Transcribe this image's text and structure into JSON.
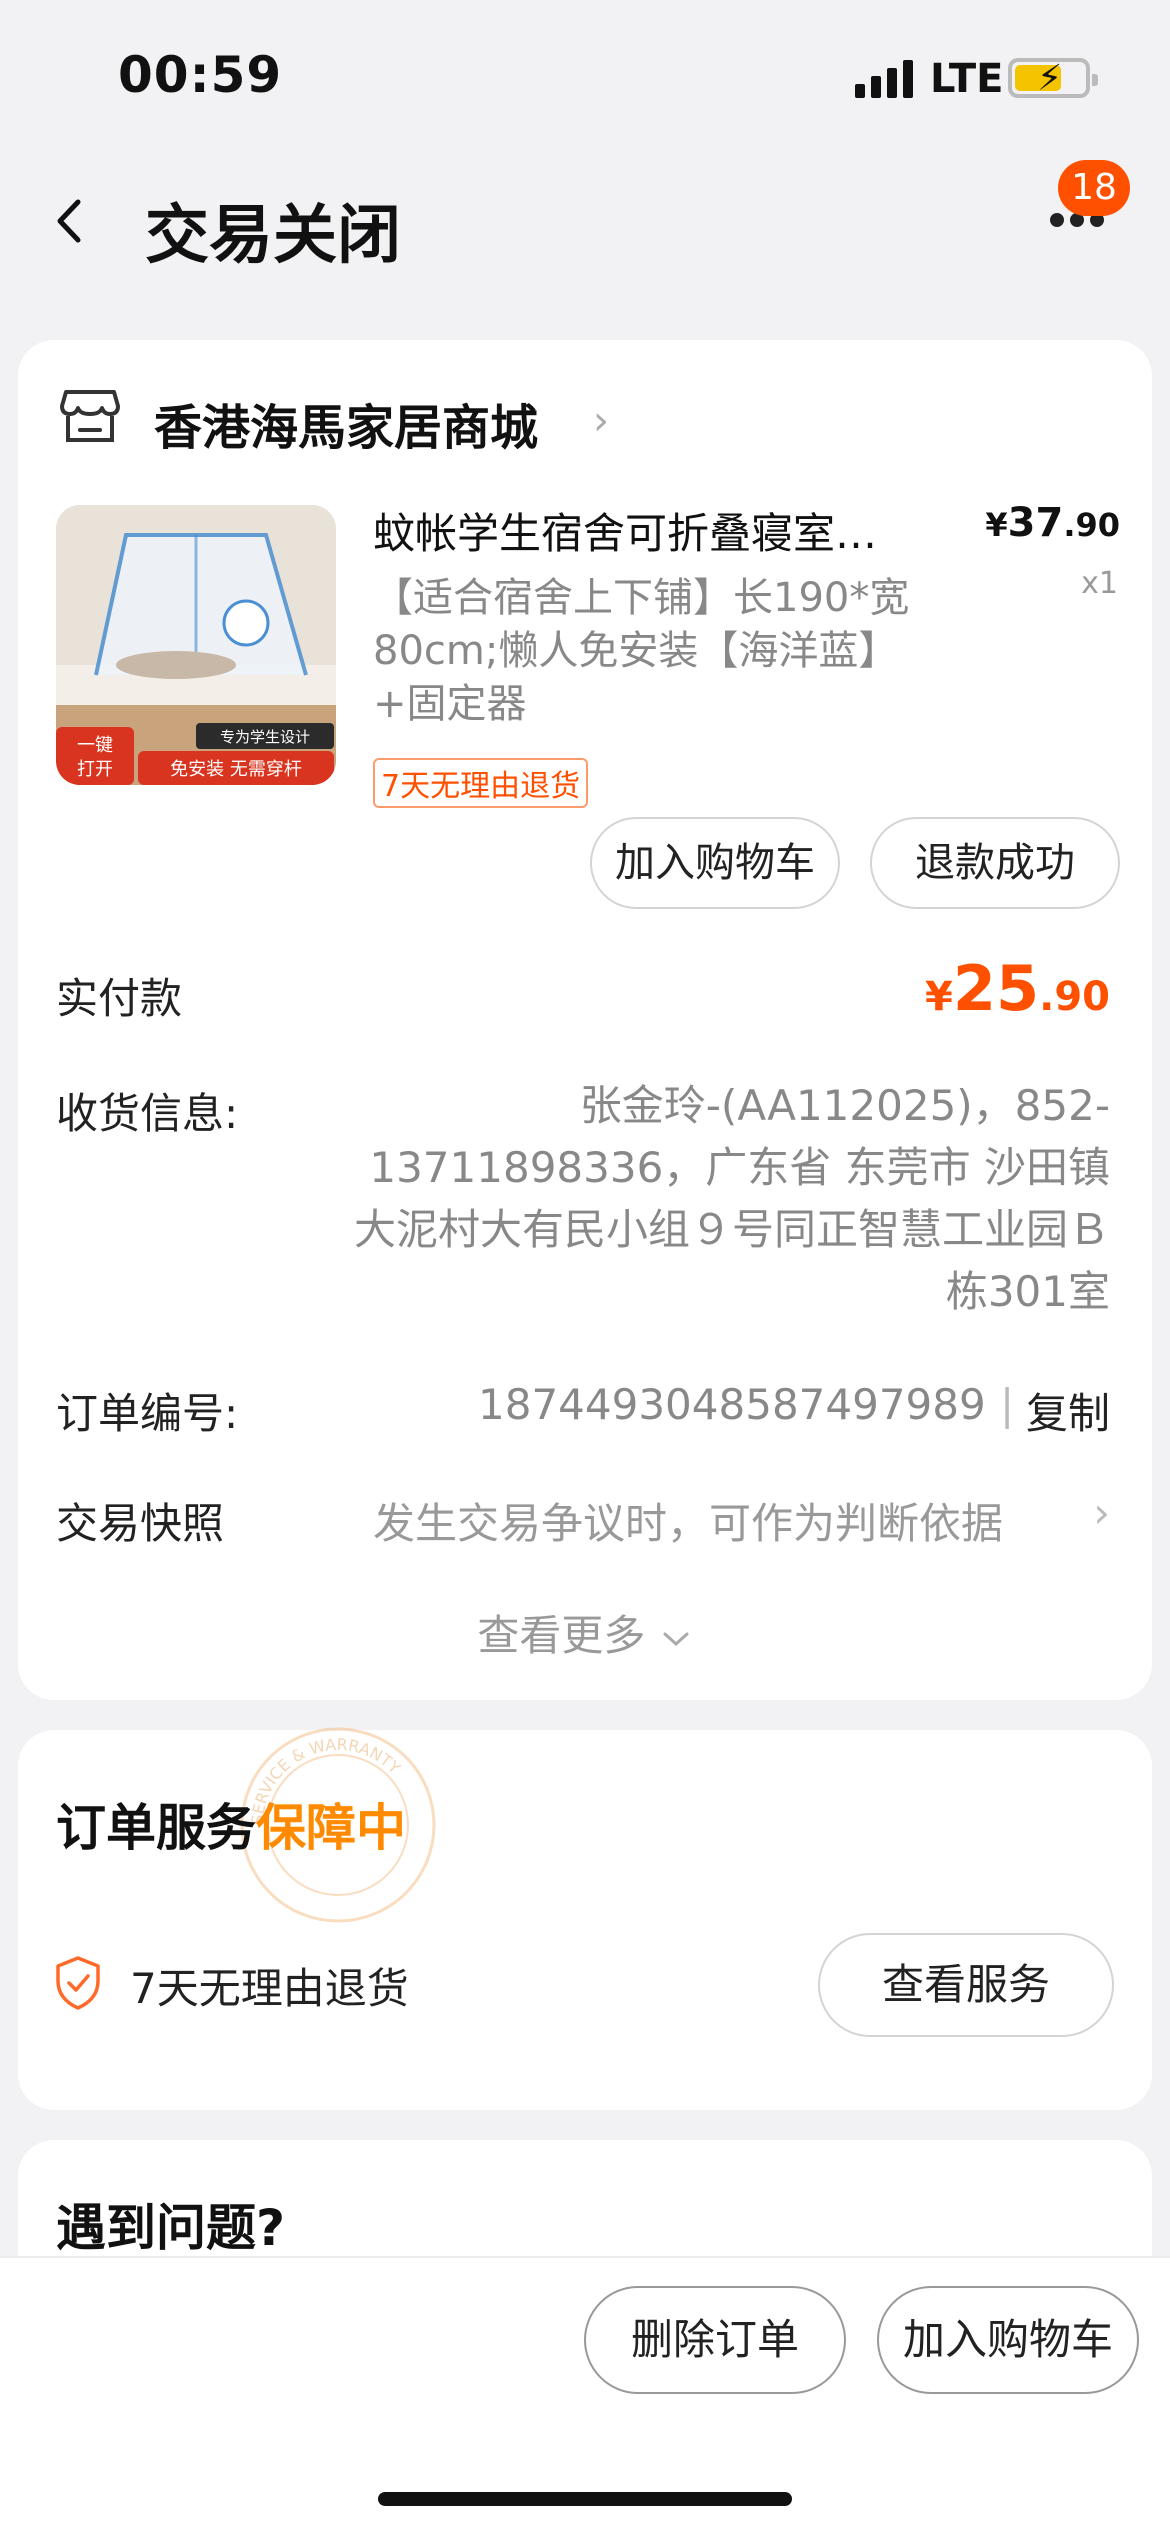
{
  "status_bar": {
    "time": "00:59",
    "network": "LTE"
  },
  "header": {
    "title": "交易关闭",
    "badge_count": "18"
  },
  "shop": {
    "name": "香港海馬家居商城"
  },
  "product": {
    "title": "蚊帐学生宿舍可折叠寝室…",
    "price_symbol": "¥",
    "price_int": "37",
    "price_dec": ".90",
    "qty": "x1",
    "spec": "【适合宿舍上下铺】长190*宽80cm;懒人免安装【海洋蓝】+固定器",
    "return_tag": "7天无理由退货",
    "thumb_texts": {
      "promo1": "一键打开",
      "promo2": "免安装 无需穿杆",
      "promo3": "专为学生设计"
    }
  },
  "actions": {
    "add_cart": "加入购物车",
    "refund": "退款成功"
  },
  "payment": {
    "label": "实付款",
    "symbol": "¥",
    "int": "25",
    "dec": ".90"
  },
  "address": {
    "label": "收货信息:",
    "value": "张金玲-(AA112025)，852-13711898336，广东省 东莞市 沙田镇 大泥村大有民小组９号同正智慧工业园Ｂ栋301室"
  },
  "order": {
    "label": "订单编号:",
    "number": "1874493048587497989",
    "sep": "|",
    "copy": "复制"
  },
  "snapshot": {
    "label": "交易快照",
    "value": "发生交易争议时，可作为判断依据"
  },
  "view_more": "查看更多",
  "service": {
    "title_prefix": "订单服务",
    "title_highlight": "保障中",
    "stamp_text": "SERVICE & WARRANTY",
    "item": "7天无理由退货",
    "button": "查看服务"
  },
  "faq": {
    "title": "遇到问题?"
  },
  "bottom": {
    "delete": "删除订单",
    "add_cart": "加入购物车"
  },
  "colors": {
    "accent": "#ff5000",
    "highlight": "#ff8a00",
    "page_bg": "#f2f2f4"
  }
}
